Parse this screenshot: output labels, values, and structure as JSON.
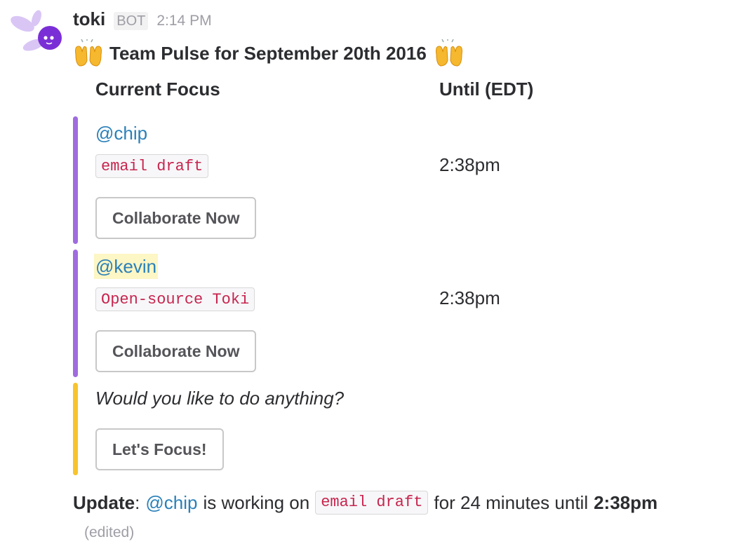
{
  "message": {
    "bot_name": "toki",
    "bot_badge": "BOT",
    "timestamp": "2:14 PM",
    "avatar_icon": "purple-fairy-icon",
    "title": "Team Pulse for September 20th 2016",
    "title_emoji": "raised-hands-icon"
  },
  "table": {
    "col_focus": "Current Focus",
    "col_until": "Until (EDT)"
  },
  "entries": [
    {
      "user": "@chip",
      "task": "email draft",
      "until": "2:38pm",
      "button_label": "Collaborate Now",
      "accent_color": "#a06be0"
    },
    {
      "user": "@kevin",
      "task": "Open-source Toki",
      "until": "2:38pm",
      "button_label": "Collaborate Now",
      "accent_color": "#a06be0"
    }
  ],
  "prompt": {
    "text": "Would you like to do anything?",
    "button_label": "Let's Focus!",
    "accent_color": "#f8c42c"
  },
  "update": {
    "label": "Update",
    "colon": ":",
    "user": "@chip",
    "text_before": "is working on",
    "task": "email draft",
    "text_after": "for 24 minutes until",
    "time": "2:38pm",
    "edited": "(edited)"
  }
}
